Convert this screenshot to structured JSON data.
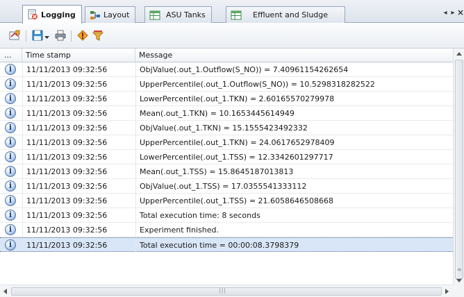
{
  "tabs": [
    {
      "label": "Logging",
      "icon": "logging-icon",
      "active": true
    },
    {
      "label": "Layout",
      "icon": "layout-icon",
      "active": false
    },
    {
      "label": "ASU Tanks",
      "icon": "table-icon",
      "active": false
    },
    {
      "label": "Effluent and Sludge",
      "icon": "table-icon",
      "active": false
    }
  ],
  "tab_nav": {
    "prev": "◂",
    "next": "▸",
    "close": "×"
  },
  "toolbar": {
    "buttons": [
      "clear-log-icon",
      "save-icon",
      "dropdown-arrow-icon",
      "print-icon",
      "warning-filter-icon",
      "filter-icon"
    ]
  },
  "table": {
    "columns": [
      "...",
      "Time stamp",
      "Message"
    ],
    "rows": [
      {
        "time": "11/11/2013 09:32:56",
        "message": "ObjValue(.out_1.Outflow(S_NO)) = 7.40961154262654"
      },
      {
        "time": "11/11/2013 09:32:56",
        "message": "UpperPercentile(.out_1.Outflow(S_NO)) = 10.5298318282522"
      },
      {
        "time": "11/11/2013 09:32:56",
        "message": "LowerPercentile(.out_1.TKN) = 2.60165570279978"
      },
      {
        "time": "11/11/2013 09:32:56",
        "message": "Mean(.out_1.TKN) = 10.1653445614949"
      },
      {
        "time": "11/11/2013 09:32:56",
        "message": "ObjValue(.out_1.TKN) = 15.1555423492332"
      },
      {
        "time": "11/11/2013 09:32:56",
        "message": "UpperPercentile(.out_1.TKN) = 24.0617652978409"
      },
      {
        "time": "11/11/2013 09:32:56",
        "message": "LowerPercentile(.out_1.TSS) = 12.3342601297717"
      },
      {
        "time": "11/11/2013 09:32:56",
        "message": "Mean(.out_1.TSS) = 15.8645187013813"
      },
      {
        "time": "11/11/2013 09:32:56",
        "message": "ObjValue(.out_1.TSS) = 17.0355541333112"
      },
      {
        "time": "11/11/2013 09:32:56",
        "message": "UpperPercentile(.out_1.TSS) = 21.6058646508668"
      },
      {
        "time": "11/11/2013 09:32:56",
        "message": "Total execution time: 8 seconds"
      },
      {
        "time": "11/11/2013 09:32:56",
        "message": "Experiment finished."
      },
      {
        "time": "11/11/2013 09:32:56",
        "message": "Total execution time = 00:00:08.3798379",
        "selected": true
      }
    ]
  },
  "colors": {
    "selection": "#d9e6f7",
    "info_icon": "#4f74a8"
  }
}
